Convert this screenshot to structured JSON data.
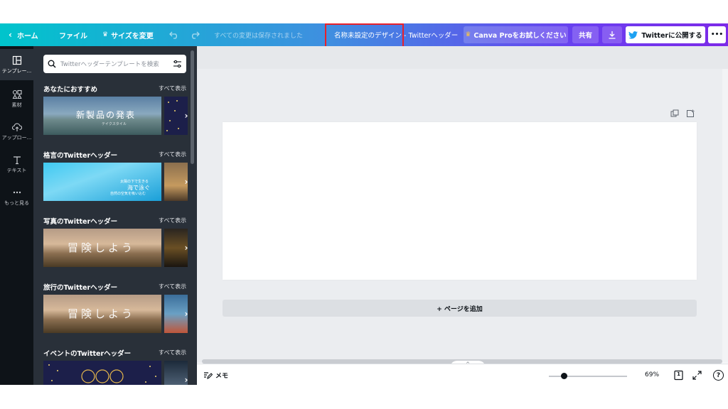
{
  "topbar": {
    "home": "ホーム",
    "file": "ファイル",
    "resize": "サイズを変更",
    "saved_status": "すべての変更は保存されました",
    "design_title": "名称未設定のデザイン - Twitterヘッダー",
    "canva_pro": "Canva Proをお試しください",
    "share": "共有",
    "publish": "Twitterに公開する",
    "more": "•••"
  },
  "rail": {
    "items": [
      {
        "label": "テンプレー..."
      },
      {
        "label": "素材"
      },
      {
        "label": "アップロー..."
      },
      {
        "label": "テキスト"
      },
      {
        "label": "もっと見る"
      }
    ]
  },
  "panel": {
    "search_placeholder": "Twitterヘッダーテンプレートを検索",
    "see_all": "すべて表示",
    "sections": [
      {
        "title": "あなたにおすすめ",
        "thumb_text": "新製品の発表",
        "thumb_sub": "テイクスタイル"
      },
      {
        "title": "格言のTwitterヘッダー",
        "thumb_line1": "太陽の下で生きる",
        "thumb_line2": "海で泳ぐ",
        "thumb_line3": "自然の空気を吸い込む"
      },
      {
        "title": "写真のTwitterヘッダー",
        "thumb_text": "冒険しよう"
      },
      {
        "title": "旅行のTwitterヘッダー",
        "thumb_text": "冒険しよう"
      },
      {
        "title": "イベントのTwitterヘッダー"
      }
    ]
  },
  "canvas": {
    "add_page": "+ ページを追加"
  },
  "bottombar": {
    "memo": "メモ",
    "zoom_percent": 69,
    "zoom_label": "69%",
    "page_count": "1",
    "help": "?"
  },
  "colors": {
    "topbar_start": "#00c4cc",
    "topbar_end": "#7d2ae8",
    "panel_bg": "#293039",
    "rail_bg": "#0e1318",
    "highlight": "#e8202a"
  }
}
